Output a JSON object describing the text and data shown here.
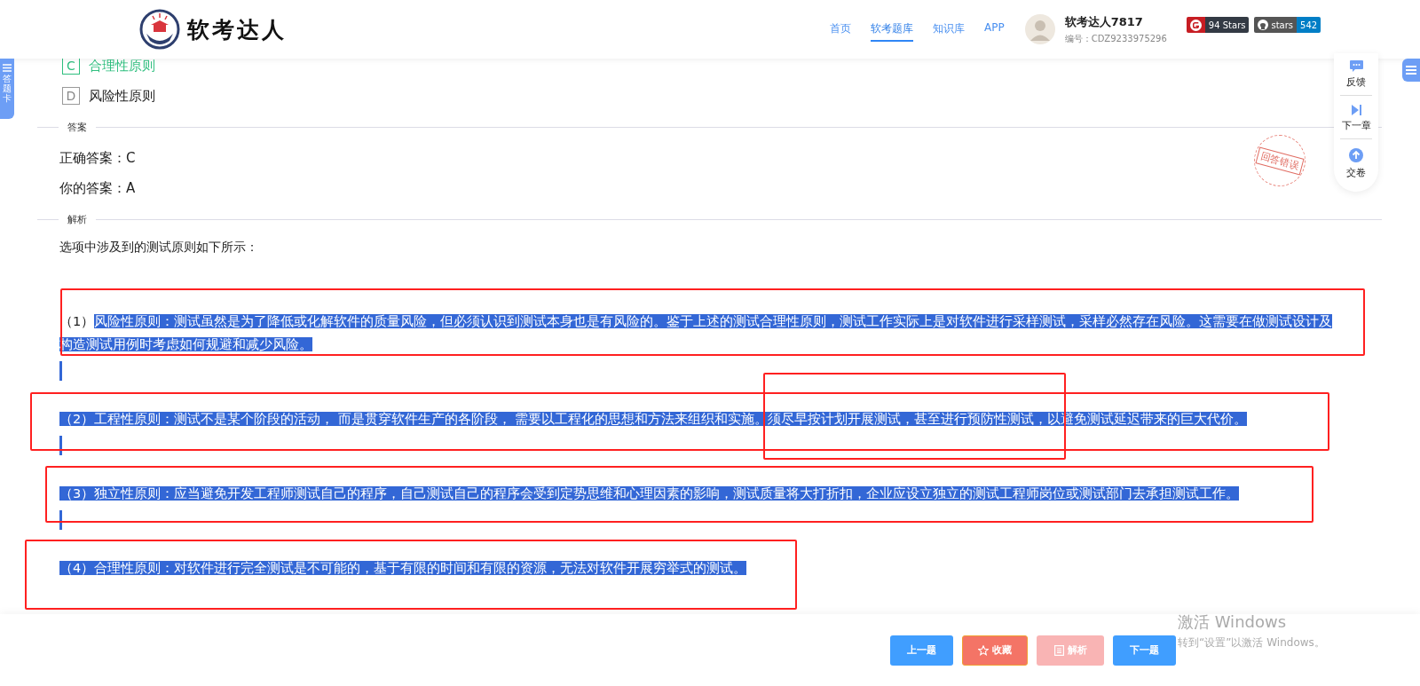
{
  "header": {
    "logo_text": "软考达人",
    "nav": [
      {
        "label": "首页",
        "selected": false
      },
      {
        "label": "软考题库",
        "selected": true
      },
      {
        "label": "知识库",
        "selected": false
      },
      {
        "label": "APP",
        "selected": false
      }
    ],
    "user": {
      "name": "软考达人7817",
      "id_label": "编号：CDZ9233975296"
    },
    "badges": [
      {
        "kind": "gitee",
        "value": "94 Stars"
      },
      {
        "kind": "github",
        "label": "stars",
        "value": "542"
      }
    ]
  },
  "left_tab": {
    "label": "答题卡"
  },
  "options": [
    {
      "letter": "C",
      "text": "合理性原则",
      "correct": true
    },
    {
      "letter": "D",
      "text": "风险性原则",
      "correct": false
    }
  ],
  "answer_section": {
    "title": "答案",
    "lines": [
      "正确答案：C",
      "你的答案：A"
    ],
    "stamp": "回答错误"
  },
  "analysis_section": {
    "title": "解析",
    "intro": "选项中涉及到的测试原则如下所示：",
    "principles": [
      {
        "number": "（1）",
        "number_selected": false,
        "text": "风险性原则：测试虽然是为了降低或化解软件的质量风险，但必须认识到测试本身也是有风险的。鉴于上述的测试合理性原则，测试工作实际上是对软件进行采样测试，采样必然存在风险。这需要在做测试设计及构造测试用例时考虑如何规避和减少风险。",
        "selected": true
      },
      {
        "number": "（2）",
        "number_selected": true,
        "text": "工程性原则：测试不是某个阶段的活动， 而是贯穿软件生产的各阶段， 需要以工程化的思想和方法来组织和实施。须尽早按计划开展测试，甚至进行预防性测试，以避免测试延迟带来的巨大代价。",
        "selected": true
      },
      {
        "number": "（3）",
        "number_selected": true,
        "text": "独立性原则：应当避免开发工程师测试自己的程序，自己测试自己的程序会受到定势思维和心理因素的影响，测试质量将大打折扣，企业应设立独立的测试工程师岗位或测试部门去承担测试工作。",
        "selected": true
      },
      {
        "number": "（4）",
        "number_selected": true,
        "text": "合理性原则：对软件进行完全测试是不可能的，基于有限的时间和有限的资源，无法对软件开展穷举式的测试。",
        "selected": true
      }
    ]
  },
  "side_panel": [
    {
      "kind": "feedback",
      "label": "反馈"
    },
    {
      "kind": "next",
      "label": "下一章"
    },
    {
      "kind": "submit",
      "label": "交卷"
    }
  ],
  "buttons": [
    {
      "kind": "primary",
      "label": "上一题",
      "disabled": false
    },
    {
      "kind": "favorite",
      "label": "收藏",
      "disabled": false
    },
    {
      "kind": "analysis",
      "label": "解析",
      "disabled": true
    },
    {
      "kind": "primary",
      "label": "下一题",
      "disabled": false
    }
  ],
  "os_notice": {
    "title": "激活 Windows",
    "text": "转到“设置”以激活 Windows。"
  }
}
